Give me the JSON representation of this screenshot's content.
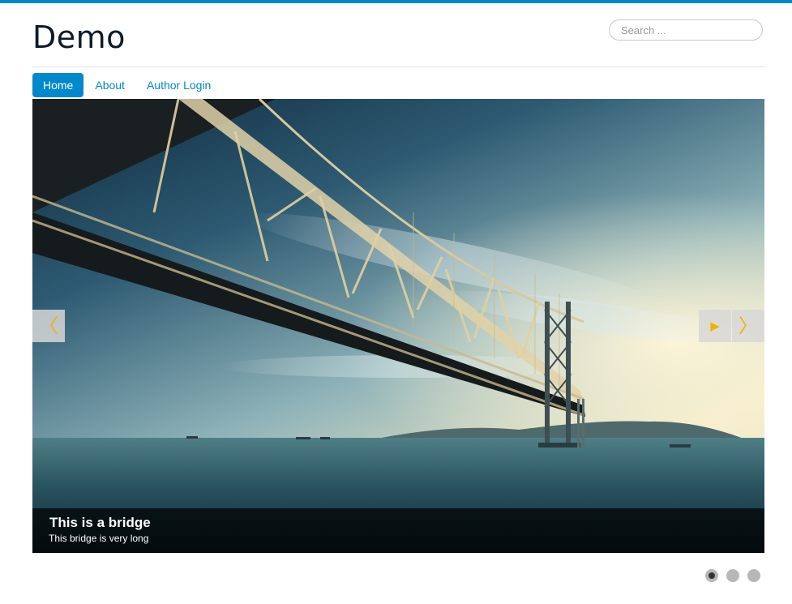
{
  "site": {
    "title": "Demo"
  },
  "search": {
    "placeholder": "Search ..."
  },
  "nav": {
    "items": [
      {
        "label": "Home",
        "active": true
      },
      {
        "label": "About",
        "active": false
      },
      {
        "label": "Author Login",
        "active": false
      }
    ]
  },
  "slideshow": {
    "caption_title": "This is a bridge",
    "caption_text": "This bridge is very long",
    "prev_icon": "chevron-left-icon",
    "play_icon": "play-icon",
    "next_icon": "chevron-right-icon",
    "slide_count": 3,
    "current_slide": 1
  },
  "colors": {
    "accent": "#0088cc",
    "control_arrow": "#f0b400"
  }
}
